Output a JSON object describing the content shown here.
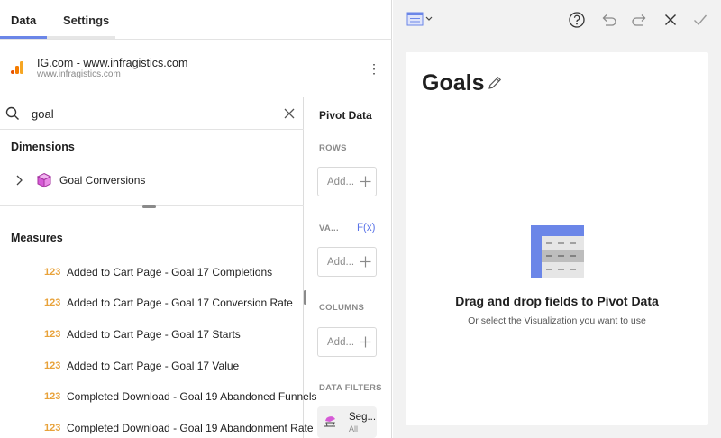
{
  "tabs": [
    {
      "label": "Data"
    },
    {
      "label": "Settings"
    }
  ],
  "datasource": {
    "name": "IG.com - www.infragistics.com",
    "url": "www.infragistics.com"
  },
  "search": {
    "value": "goal"
  },
  "dimensions": {
    "title": "Dimensions",
    "items": [
      {
        "label": "Goal Conversions"
      }
    ]
  },
  "measures": {
    "title": "Measures",
    "type_badge": "123",
    "items": [
      {
        "label": "Added to Cart Page - Goal 17 Completions"
      },
      {
        "label": "Added to Cart Page - Goal 17 Conversion Rate"
      },
      {
        "label": "Added to Cart Page - Goal 17 Starts"
      },
      {
        "label": "Added to Cart Page - Goal 17 Value"
      },
      {
        "label": "Completed Download - Goal 19 Abandoned Funnels"
      },
      {
        "label": "Completed Download - Goal 19 Abandonment Rate"
      }
    ]
  },
  "pivot": {
    "title": "Pivot Data",
    "rows_label": "ROWS",
    "values_label": "VA...",
    "fx_label": "F(x)",
    "columns_label": "COLUMNS",
    "filters_label": "DATA FILTERS",
    "add_label": "Add...",
    "filter_chip": {
      "name": "Seg...",
      "sub": "All"
    }
  },
  "visualization": {
    "title": "Goals",
    "empty_title": "Drag and drop fields to Pivot Data",
    "empty_subtitle": "Or select the Visualization you want to use"
  },
  "colors": {
    "accent": "#6b86e8",
    "measure_badge": "#e8a23a",
    "cube": "#d65ad6",
    "logo_orange": "#f6a623"
  },
  "icons": [
    "grid-viz-icon",
    "help-icon",
    "undo-icon",
    "redo-icon",
    "close-icon",
    "check-icon",
    "pencil-icon",
    "search-icon",
    "cube-icon"
  ]
}
